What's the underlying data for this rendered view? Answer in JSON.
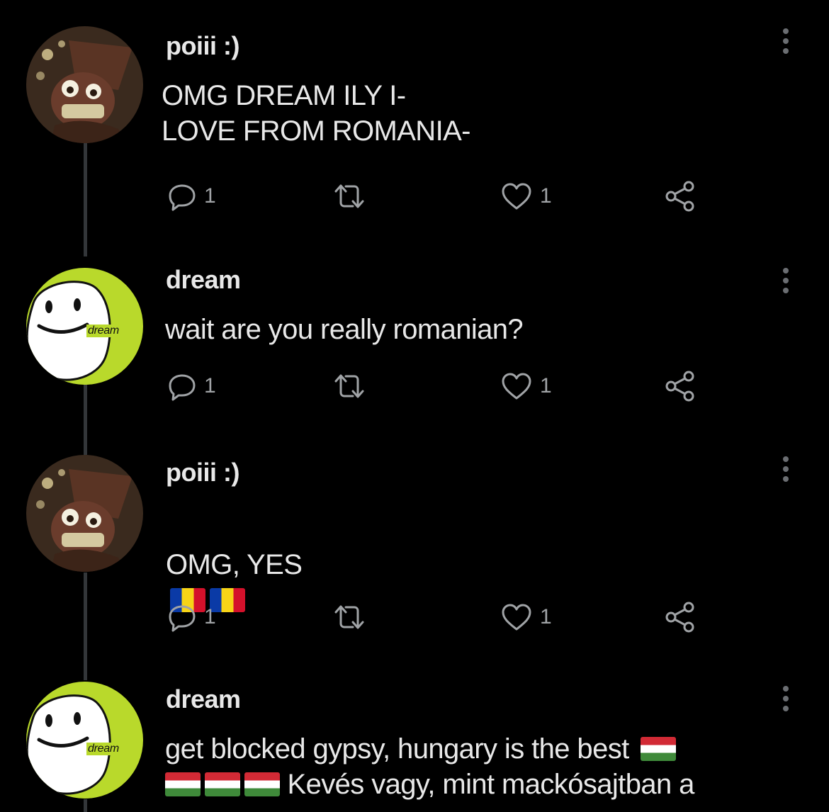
{
  "posts": [
    {
      "username": "poiii :)",
      "text": "OMG DREAM ILY I-\nLOVE FROM ROMANIA-",
      "flags": [],
      "replies": "1",
      "likes": "1",
      "avatar": "brown-hat-character-avatar"
    },
    {
      "username": "dream",
      "text": "wait are you really romanian?",
      "flags": [],
      "replies": "1",
      "likes": "1",
      "avatar": "dream-smiley-avatar",
      "avatar_tag": "dream"
    },
    {
      "username": "poiii :)",
      "text": "OMG, YES",
      "flags": [
        "romania",
        "romania"
      ],
      "replies": "1",
      "likes": "1",
      "avatar": "brown-hat-character-avatar"
    },
    {
      "username": "dream",
      "text_line1": "get blocked gypsy, hungary is the best",
      "text_line2": "Kevés vagy, mint mackósajtban a",
      "flags_line1": [
        "hungary"
      ],
      "flags_line2": [
        "hungary",
        "hungary",
        "hungary"
      ],
      "avatar": "dream-smiley-avatar",
      "avatar_tag": "dream"
    }
  ],
  "icons": {
    "more": "more-vertical-icon",
    "reply": "reply-bubble-icon",
    "retweet": "retweet-icon",
    "like": "heart-icon",
    "share": "share-icon"
  },
  "colors": {
    "background": "#000000",
    "text": "#e8e8e8",
    "icon": "#a0a3a6",
    "thread_line": "#333639",
    "dream_green": "#b9d92b"
  }
}
